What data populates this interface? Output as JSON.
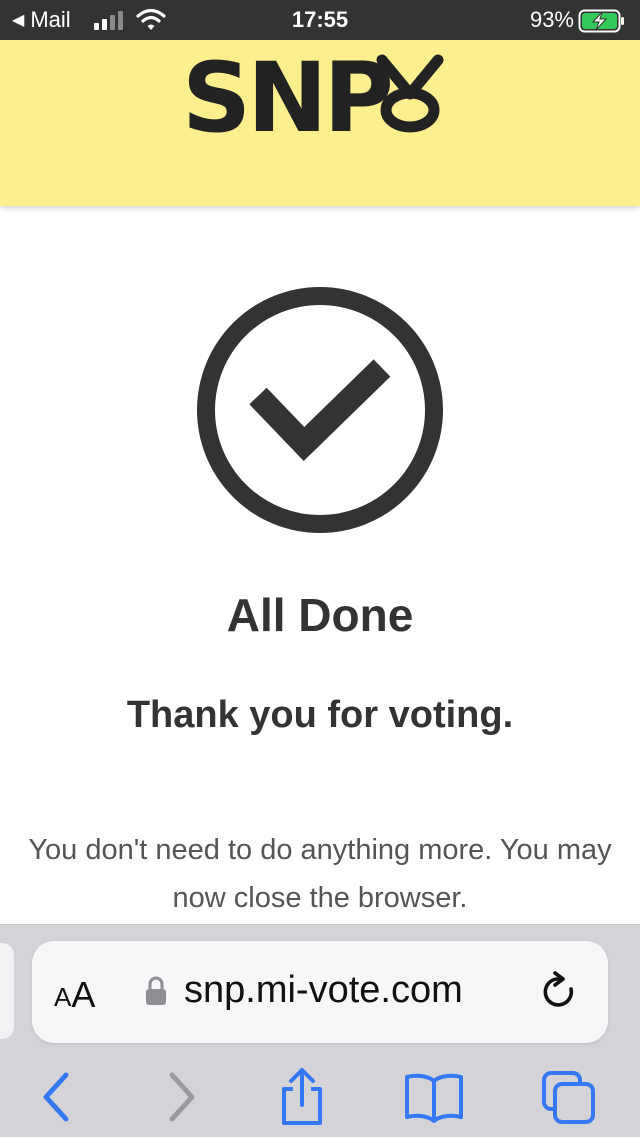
{
  "status_bar": {
    "back_app": "Mail",
    "time": "17:55",
    "battery_percent": "93%",
    "signal_bars_active": 2,
    "signal_bars_total": 4
  },
  "header": {
    "logo_text": "SNP",
    "background_color": "#fcef8e"
  },
  "main": {
    "icon": "check-circle-icon",
    "title": "All Done",
    "subtitle": "Thank you for voting.",
    "message": "You don't need to do anything more. You may now close the browser."
  },
  "browser": {
    "aa_small": "A",
    "aa_large": "A",
    "url": "snp.mi-vote.com",
    "accent_color": "#3478f6",
    "toolbar": [
      "back-icon",
      "forward-icon",
      "share-icon",
      "bookmarks-icon",
      "tabs-icon"
    ]
  }
}
